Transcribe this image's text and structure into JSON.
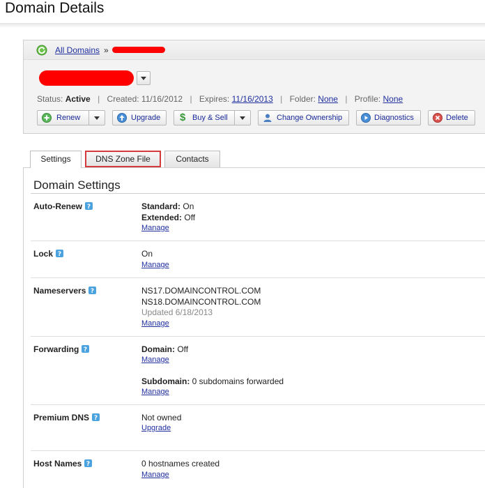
{
  "page": {
    "title": "Domain Details"
  },
  "breadcrumb": {
    "root_label": "All Domains",
    "separator": "»"
  },
  "status": {
    "status_label": "Status:",
    "status_value": "Active",
    "created_label": "Created:",
    "created_value": "11/16/2012",
    "expires_label": "Expires:",
    "expires_value": "11/16/2013",
    "folder_label": "Folder:",
    "folder_value": "None",
    "profile_label": "Profile:",
    "profile_value": "None"
  },
  "toolbar": {
    "renew": "Renew",
    "upgrade": "Upgrade",
    "buy_sell": "Buy & Sell",
    "change_ownership": "Change Ownership",
    "diagnostics": "Diagnostics",
    "delete": "Delete"
  },
  "tabs": [
    {
      "label": "Settings"
    },
    {
      "label": "DNS Zone File"
    },
    {
      "label": "Contacts"
    }
  ],
  "settings": {
    "heading": "Domain Settings",
    "auto_renew": {
      "label": "Auto-Renew",
      "standard_label": "Standard:",
      "standard_value": "On",
      "extended_label": "Extended:",
      "extended_value": "Off",
      "link": "Manage"
    },
    "lock": {
      "label": "Lock",
      "value": "On",
      "link": "Manage"
    },
    "nameservers": {
      "label": "Nameservers",
      "ns1": "NS17.DOMAINCONTROL.COM",
      "ns2": "NS18.DOMAINCONTROL.COM",
      "updated": "Updated 6/18/2013",
      "link": "Manage"
    },
    "forwarding": {
      "label": "Forwarding",
      "domain_label": "Domain:",
      "domain_value": "Off",
      "link1": "Manage",
      "subdomain_label": "Subdomain:",
      "subdomain_value": "0 subdomains forwarded",
      "link2": "Manage"
    },
    "premium_dns": {
      "label": "Premium DNS",
      "value": "Not owned",
      "link": "Upgrade"
    },
    "host_names": {
      "label": "Host Names",
      "value": "0 hostnames created",
      "link": "Manage"
    }
  },
  "colors": {
    "link": "#1f2fa0",
    "highlight_border": "#d43a3a",
    "redaction": "#ff0000"
  }
}
